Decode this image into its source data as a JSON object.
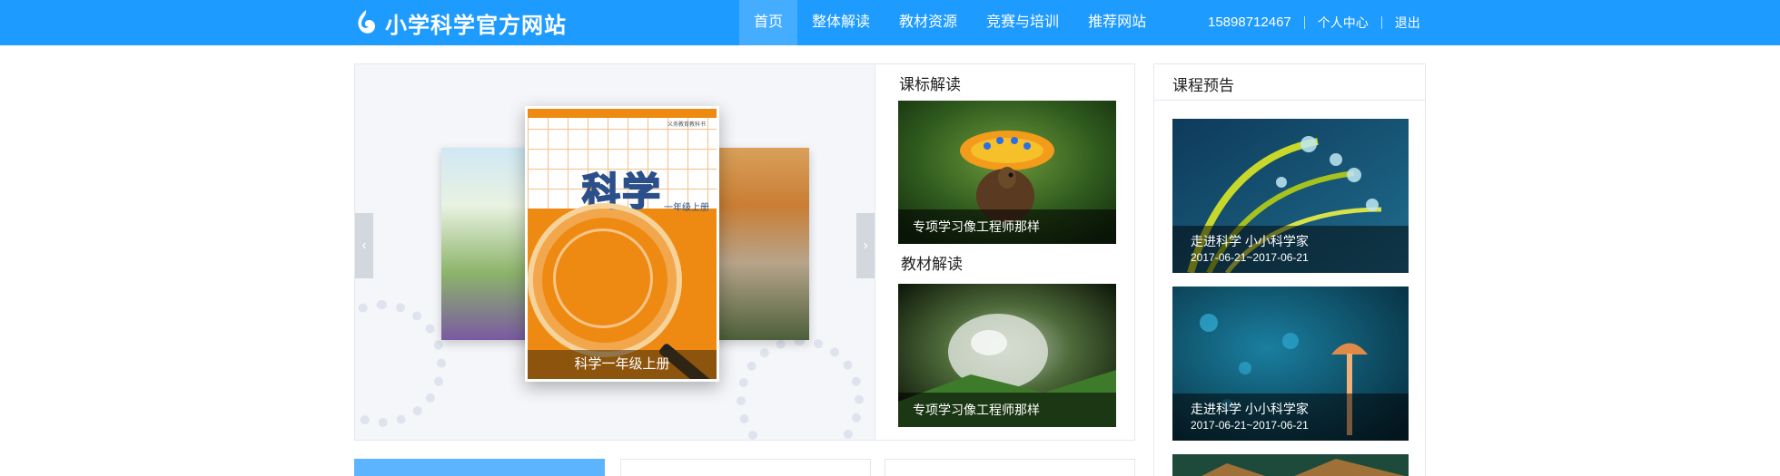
{
  "header": {
    "site_title": "小学科学官方网站",
    "logo_icon": "flame-swirl-icon",
    "nav": [
      {
        "label": "首页",
        "active": true
      },
      {
        "label": "整体解读",
        "active": false
      },
      {
        "label": "教材资源",
        "active": false
      },
      {
        "label": "竞赛与培训",
        "active": false
      },
      {
        "label": "推荐网站",
        "active": false
      }
    ],
    "user": {
      "phone": "15898712467",
      "center": "个人中心",
      "logout": "退出"
    },
    "brand_color": "#1e9bff"
  },
  "carousel": {
    "caption": "科学一年级上册",
    "cover_title": "科学",
    "cover_sub": "一年级上册",
    "cover_top": "义务教育教科书",
    "prev_icon": "chevron-left-icon",
    "next_icon": "chevron-right-icon"
  },
  "middle": {
    "section1_title": "课标解读",
    "section1_caption": "专项学习像工程师那样",
    "section2_title": "教材解读",
    "section2_caption": "专项学习像工程师那样"
  },
  "preview": {
    "title": "课程预告",
    "items": [
      {
        "title": "走进科学 小小科学家",
        "date": "2017-06-21~2017-06-21"
      },
      {
        "title": "走进科学 小小科学家",
        "date": "2017-06-21~2017-06-21"
      }
    ]
  }
}
